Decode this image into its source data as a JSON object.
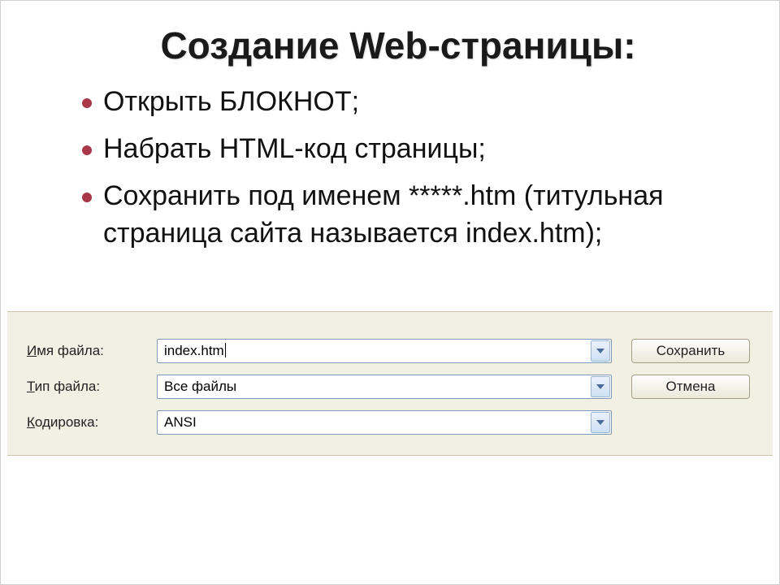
{
  "title": "Создание Web-страницы:",
  "bullets": [
    "Открыть  БЛОКНОТ;",
    "Набрать HTML-код страницы;",
    "Сохранить под именем *****.htm (титульная страница сайта называется index.htm);"
  ],
  "dialog": {
    "filename_label_prefix": "И",
    "filename_label_rest": "мя файла:",
    "filename_value": "index.htm",
    "filetype_label_prefix": "Т",
    "filetype_label_rest": "ип файла:",
    "filetype_value": "Все файлы",
    "encoding_label_prefix": "К",
    "encoding_label_rest": "одировка:",
    "encoding_value": "ANSI",
    "save_button": "Сохранить",
    "cancel_button": "Отмена"
  }
}
